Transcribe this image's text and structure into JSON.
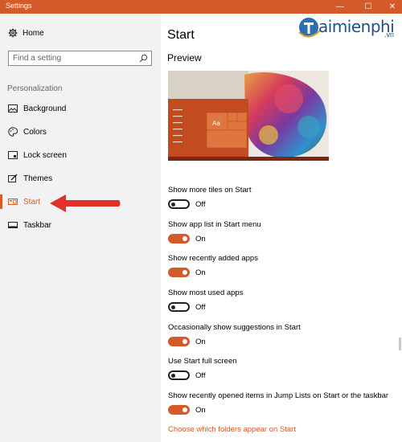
{
  "window": {
    "title": "Settings",
    "minimize": "—",
    "maximize": "☐",
    "close": "✕"
  },
  "watermark": {
    "brand": "aimienphi",
    "tld": ".vn"
  },
  "sidebar": {
    "home_label": "Home",
    "search": {
      "placeholder": "Find a setting"
    },
    "section_label": "Personalization",
    "items": [
      {
        "label": "Background",
        "icon": "image-icon",
        "active": false
      },
      {
        "label": "Colors",
        "icon": "palette-icon",
        "active": false
      },
      {
        "label": "Lock screen",
        "icon": "lock-screen-icon",
        "active": false
      },
      {
        "label": "Themes",
        "icon": "brush-icon",
        "active": false
      },
      {
        "label": "Start",
        "icon": "start-icon",
        "active": true
      },
      {
        "label": "Taskbar",
        "icon": "taskbar-icon",
        "active": false
      }
    ]
  },
  "main": {
    "title": "Start",
    "preview_label": "Preview",
    "preview": {
      "tile_label": "Aa"
    },
    "settings": [
      {
        "label": "Show more tiles on Start",
        "state": "Off"
      },
      {
        "label": "Show app list in Start menu",
        "state": "On"
      },
      {
        "label": "Show recently added apps",
        "state": "On"
      },
      {
        "label": "Show most used apps",
        "state": "Off"
      },
      {
        "label": "Occasionally show suggestions in Start",
        "state": "On"
      },
      {
        "label": "Use Start full screen",
        "state": "Off"
      },
      {
        "label": "Show recently opened items in Jump Lists on Start or the taskbar",
        "state": "On"
      }
    ],
    "link": "Choose which folders appear on Start"
  },
  "colors": {
    "accent": "#d55a2a",
    "sidebar_bg": "#f2f2f2"
  }
}
